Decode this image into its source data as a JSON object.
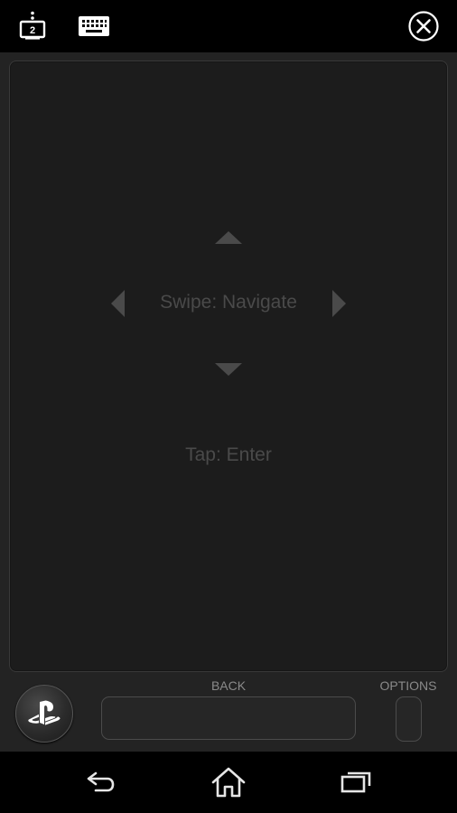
{
  "topbar": {
    "second_screen_icon": "second-screen-icon",
    "second_screen_number": "2",
    "keyboard_icon": "keyboard-icon",
    "close_icon": "close-circle-icon"
  },
  "touchpad": {
    "swipe_hint": "Swipe: Navigate",
    "tap_hint": "Tap: Enter",
    "arrows": [
      "up",
      "down",
      "left",
      "right"
    ]
  },
  "controls": {
    "ps_button_icon": "playstation-logo-icon",
    "back_label": "BACK",
    "options_label": "OPTIONS"
  },
  "navbar": {
    "back_icon": "back-arrow-icon",
    "home_icon": "home-icon",
    "recents_icon": "recents-icon"
  },
  "colors": {
    "surface": "#232323",
    "touchpad": "#1c1c1c",
    "hint_text": "#4a4a4a",
    "label_text": "#8a8a8a"
  }
}
